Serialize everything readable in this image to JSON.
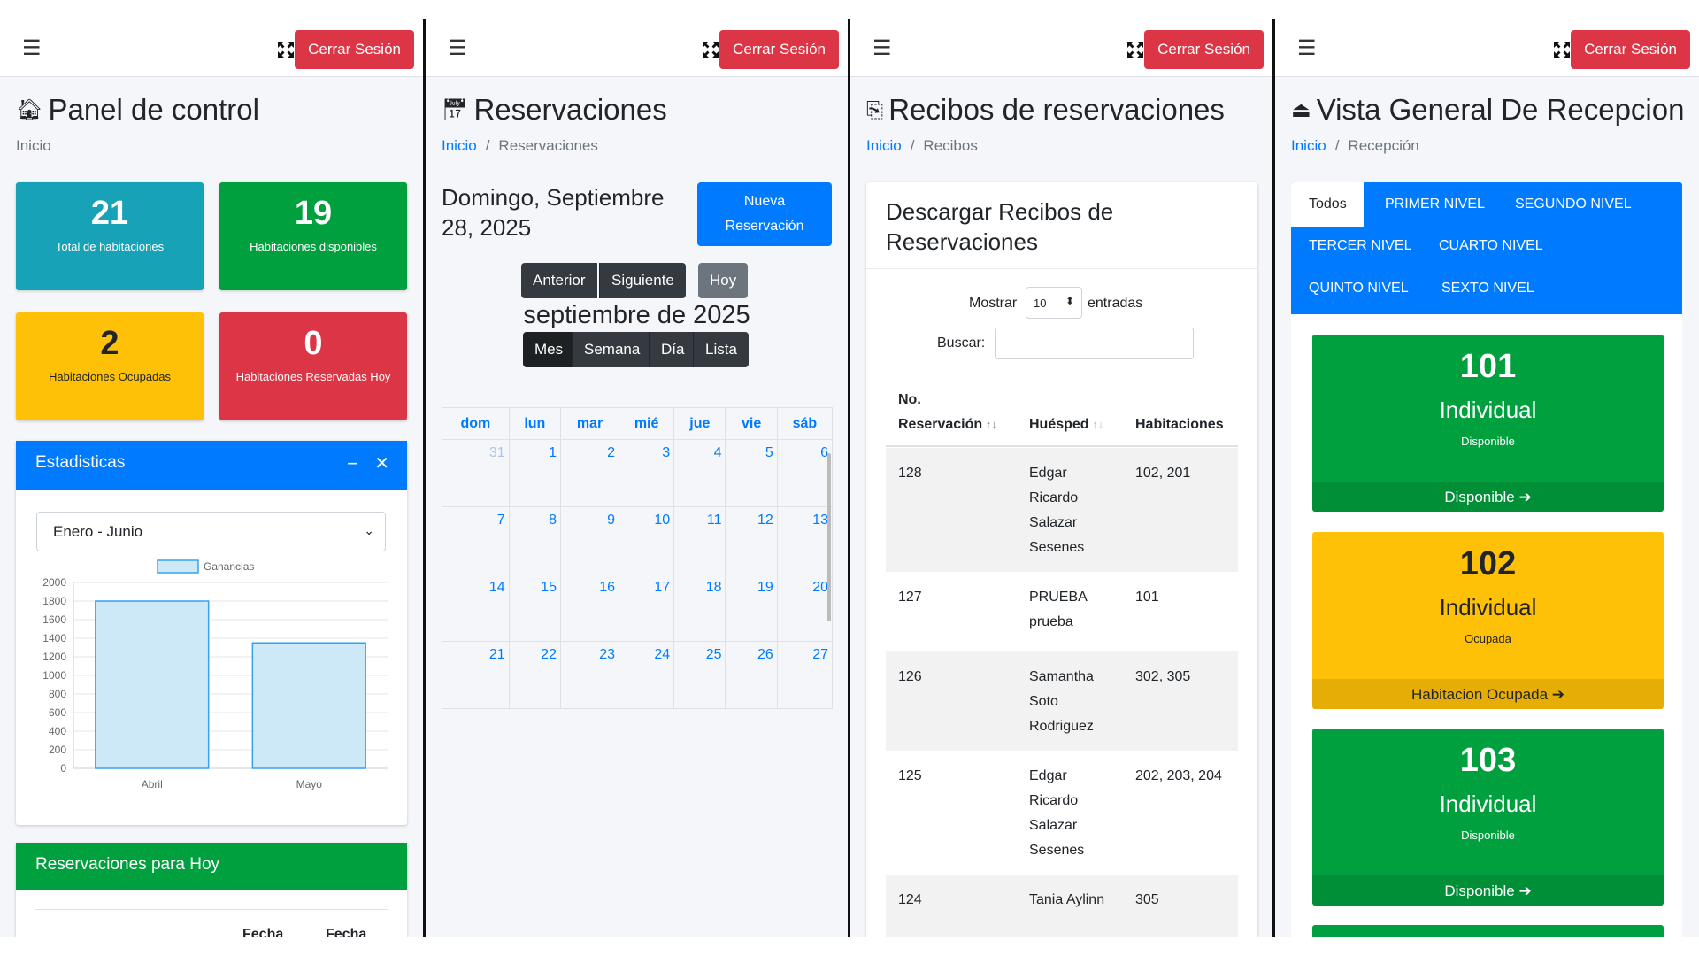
{
  "common": {
    "logout_label": "Cerrar Sesión"
  },
  "panel1": {
    "title": "Panel de control",
    "breadcrumb": "Inicio",
    "stats": [
      {
        "value": "21",
        "label": "Total de habitaciones",
        "color": "#17a2b8"
      },
      {
        "value": "19",
        "label": "Habitaciones disponibles",
        "color": "#00a03e"
      },
      {
        "value": "2",
        "label": "Habitaciones Ocupadas",
        "color": "#ffc107"
      },
      {
        "value": "0",
        "label": "Habitaciones Reservadas Hoy",
        "color": "#dc3545"
      }
    ],
    "stats_card": {
      "title": "Estadisticas",
      "select_value": "Enero - Junio"
    },
    "today_card": {
      "title": "Reservaciones para Hoy",
      "col1": "Fecha",
      "col2": "Fecha"
    }
  },
  "chart_data": {
    "type": "bar",
    "categories": [
      "Abril",
      "Mayo"
    ],
    "series": [
      {
        "name": "Ganancias",
        "values": [
          1800,
          1350
        ]
      }
    ],
    "ylim": [
      0,
      2000
    ],
    "yticks": [
      0,
      200,
      400,
      600,
      800,
      1000,
      1200,
      1400,
      1600,
      1800,
      2000
    ],
    "legend_position": "top",
    "grid": true,
    "colors": {
      "fill": "#cde9f8",
      "stroke": "#36a2eb"
    }
  },
  "panel2": {
    "title": "Reservaciones",
    "breadcrumb": {
      "home": "Inicio",
      "current": "Reservaciones"
    },
    "date": "Domingo, Septiembre 28, 2025",
    "new_button": "Nueva Reservación",
    "nav": {
      "prev": "Anterior",
      "next": "Siguiente",
      "today": "Hoy"
    },
    "month_title": "septiembre de 2025",
    "views": {
      "month": "Mes",
      "week": "Semana",
      "day": "Día",
      "list": "Lista"
    },
    "weekdays": [
      "dom",
      "lun",
      "mar",
      "mié",
      "jue",
      "vie",
      "sáb"
    ],
    "weeks": [
      [
        "31",
        "1",
        "2",
        "3",
        "4",
        "5",
        "6"
      ],
      [
        "7",
        "8",
        "9",
        "10",
        "11",
        "12",
        "13"
      ],
      [
        "14",
        "15",
        "16",
        "17",
        "18",
        "19",
        "20"
      ],
      [
        "21",
        "22",
        "23",
        "24",
        "25",
        "26",
        "27"
      ]
    ]
  },
  "panel3": {
    "title": "Recibos de reservaciones",
    "breadcrumb": {
      "home": "Inicio",
      "current": "Recibos"
    },
    "card_title": "Descargar Recibos de Reservaciones",
    "show_label": "Mostrar",
    "show_value": "10",
    "entries_label": "entradas",
    "search_label": "Buscar:",
    "headers": {
      "num": "No. Reservación",
      "guest": "Huésped",
      "rooms": "Habitaciones"
    },
    "rows": [
      {
        "num": "128",
        "guest": "Edgar Ricardo Salazar Sesenes",
        "rooms": "102, 201"
      },
      {
        "num": "127",
        "guest": "PRUEBA prueba",
        "rooms": "101"
      },
      {
        "num": "126",
        "guest": "Samantha Soto Rodriguez",
        "rooms": "302, 305"
      },
      {
        "num": "125",
        "guest": "Edgar Ricardo Salazar Sesenes",
        "rooms": "202, 203, 204"
      },
      {
        "num": "124",
        "guest": "Tania Aylinn",
        "rooms": "305"
      }
    ]
  },
  "panel4": {
    "title": "Vista General De Recepcion",
    "breadcrumb": {
      "home": "Inicio",
      "current": "Recepción"
    },
    "tabs": [
      "Todos",
      "PRIMER NIVEL",
      "SEGUNDO NIVEL",
      "TERCER NIVEL",
      "CUARTO NIVEL",
      "QUINTO NIVEL",
      "SEXTO NIVEL"
    ],
    "rooms": [
      {
        "number": "101",
        "type": "Individual",
        "status": "Disponible",
        "footer": "Disponible",
        "color": "#00a03e"
      },
      {
        "number": "102",
        "type": "Individual",
        "status": "Ocupada",
        "footer": "Habitacion Ocupada",
        "color": "#ffc107"
      },
      {
        "number": "103",
        "type": "Individual",
        "status": "Disponible",
        "footer": "Disponible",
        "color": "#00a03e"
      }
    ]
  }
}
